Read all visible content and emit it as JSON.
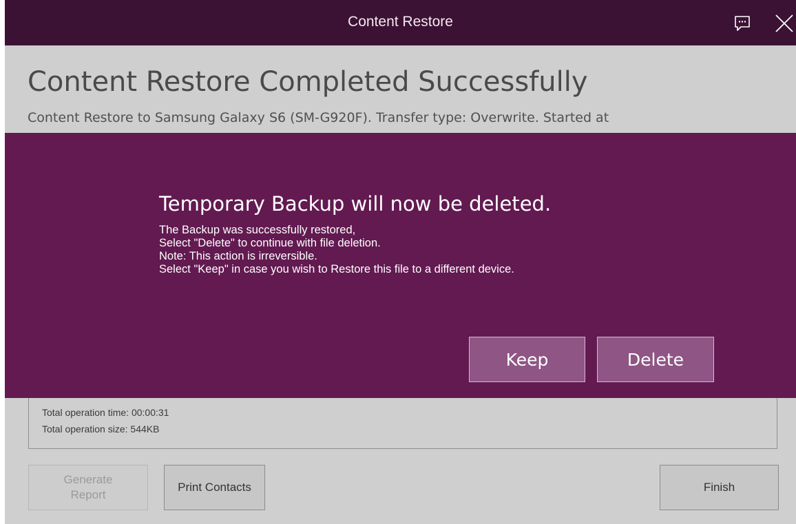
{
  "window": {
    "title": "Content Restore",
    "icons": {
      "feedback": "feedback-icon",
      "close": "close-icon"
    }
  },
  "page": {
    "title": "Content Restore Completed Successfully",
    "subtitle": "Content Restore to Samsung Galaxy S6 (SM-G920F). Transfer type: Overwrite. Started at"
  },
  "summary": {
    "lines": [
      "Total operation time: 00:00:31",
      "Total operation size: 544KB"
    ]
  },
  "footer": {
    "generate_report": "Generate Report",
    "print_contacts": "Print Contacts",
    "finish": "Finish"
  },
  "dialog": {
    "title": "Temporary Backup will now be deleted.",
    "body": [
      "The Backup was successfully restored,",
      "Select \"Delete\" to continue with file deletion.",
      "Note: This action is irreversible.",
      "Select \"Keep\" in case you wish to Restore this file to a different device."
    ],
    "keep_label": "Keep",
    "delete_label": "Delete"
  },
  "colors": {
    "titlebar": "#3c1234",
    "overlay": "#621a51",
    "dialog_button": "#8f5585",
    "background": "#cfcfcf"
  }
}
